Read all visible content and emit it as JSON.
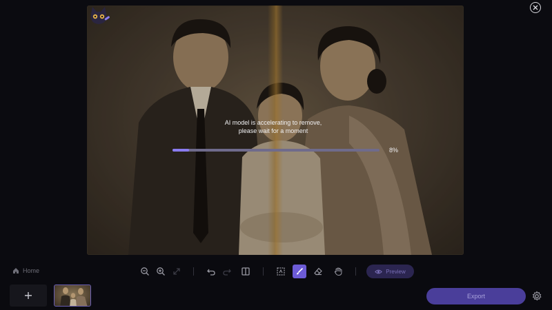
{
  "processing": {
    "message_line1": "AI model is accelerating to remove,",
    "message_line2": "please wait for a moment",
    "progress_percent_label": "8%",
    "progress_fraction": 0.08
  },
  "toolbar": {
    "home_label": "Home",
    "preview_label": "Preview",
    "icons": [
      "zoom-out-icon",
      "zoom-in-icon",
      "expand-icon",
      "undo-icon",
      "redo-icon",
      "compare-icon",
      "auto-detect-icon",
      "brush-icon",
      "eraser-icon",
      "hand-icon",
      "eye-icon"
    ]
  },
  "footer": {
    "add_icon": "plus-icon",
    "export_label": "Export",
    "settings_icon": "gear-icon"
  },
  "colors": {
    "accent": "#6c5bd6",
    "progress": "#8a7cf0",
    "export_bg": "#4a3e9a",
    "preview_bg": "#2b2550"
  }
}
